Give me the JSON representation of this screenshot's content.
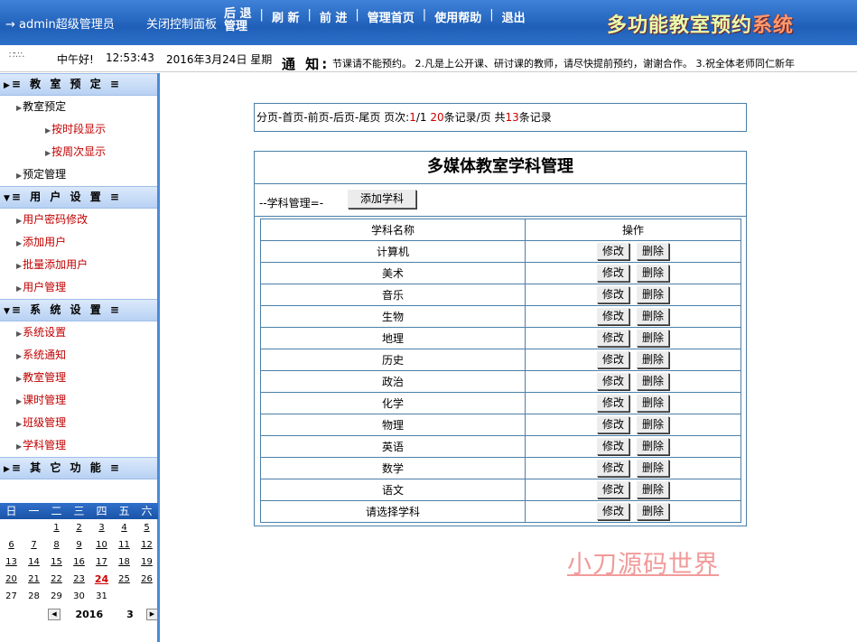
{
  "header": {
    "user": "→ admin超级管理员",
    "nav_first": "关闭控制面板",
    "nav_back_line1": "后 退",
    "nav_back_line2": "管理",
    "nav_refresh": "刷 新",
    "nav_forward": "前 进",
    "nav_home": "管理首页",
    "nav_help": "使用帮助",
    "nav_exit": "退出",
    "logo_a": "多功能教室预约",
    "logo_b": "系统"
  },
  "statusbar": {
    "loading": "∷∵∴",
    "greeting": "中午好!",
    "time": "12:53:43",
    "date": "2016年3月24日 星期",
    "notice_label": "通 知:",
    "notice_text": "节课请不能预约。 2.凡是上公开课、研讨课的教师，请尽快提前预约，谢谢合作。 3.祝全体老师同仁新年"
  },
  "sidebar": {
    "sections": [
      {
        "title": "≡ 教 室 预 定 ≡",
        "items": [
          {
            "label": "教室预定",
            "red": false,
            "sub": false
          },
          {
            "label": "按时段显示",
            "red": true,
            "sub": true
          },
          {
            "label": "按周次显示",
            "red": true,
            "sub": true
          },
          {
            "label": "预定管理",
            "red": false,
            "sub": false
          }
        ]
      },
      {
        "title": "≡ 用 户 设 置 ≡",
        "items": [
          {
            "label": "用户密码修改",
            "red": true,
            "sub": false
          },
          {
            "label": "添加用户",
            "red": true,
            "sub": false
          },
          {
            "label": "批量添加用户",
            "red": true,
            "sub": false
          },
          {
            "label": "用户管理",
            "red": true,
            "sub": false
          }
        ]
      },
      {
        "title": "≡ 系 统 设 置 ≡",
        "items": [
          {
            "label": "系统设置",
            "red": true,
            "sub": false
          },
          {
            "label": "系统通知",
            "red": true,
            "sub": false
          },
          {
            "label": "教室管理",
            "red": true,
            "sub": false
          },
          {
            "label": "课时管理",
            "red": true,
            "sub": false
          },
          {
            "label": "班级管理",
            "red": true,
            "sub": false
          },
          {
            "label": "学科管理",
            "red": true,
            "sub": false
          }
        ]
      },
      {
        "title": "≡ 其 它 功 能 ≡",
        "items": []
      }
    ]
  },
  "calendar": {
    "weekdays": [
      "日",
      "一",
      "二",
      "三",
      "四",
      "五",
      "六"
    ],
    "weeks": [
      [
        "",
        "",
        "1",
        "2",
        "3",
        "4",
        "5"
      ],
      [
        "6",
        "7",
        "8",
        "9",
        "10",
        "11",
        "12"
      ],
      [
        "13",
        "14",
        "15",
        "16",
        "17",
        "18",
        "19"
      ],
      [
        "20",
        "21",
        "22",
        "23",
        "24",
        "25",
        "26"
      ],
      [
        "27",
        "28",
        "29",
        "30",
        "31",
        "",
        ""
      ]
    ],
    "today": "24",
    "year": "2016",
    "month": "3",
    "prev": "◀",
    "next": "▶"
  },
  "pager": {
    "prefix": "分页-首页-前页-后页-尾页  页次:",
    "page_cur": "1",
    "page_sep": "/1 ",
    "per_page": "20",
    "per_page_suffix": "条记录/页 共",
    "total": "13",
    "total_suffix": "条记录"
  },
  "panel": {
    "title": "多媒体教室学科管理",
    "toolbar_label": "--学科管理=-",
    "add_button": "添加学科",
    "col_name": "学科名称",
    "col_action": "操作",
    "edit_label": "修改",
    "delete_label": "删除",
    "rows": [
      "计算机",
      "美术",
      "音乐",
      "生物",
      "地理",
      "历史",
      "政治",
      "化学",
      "物理",
      "英语",
      "数学",
      "语文",
      "请选择学科"
    ]
  },
  "watermark": "小刀源码世界",
  "colors": {
    "header_blue": "#1f5fb8",
    "side_blue": "#4b8ad8",
    "link_red": "#c00000"
  }
}
